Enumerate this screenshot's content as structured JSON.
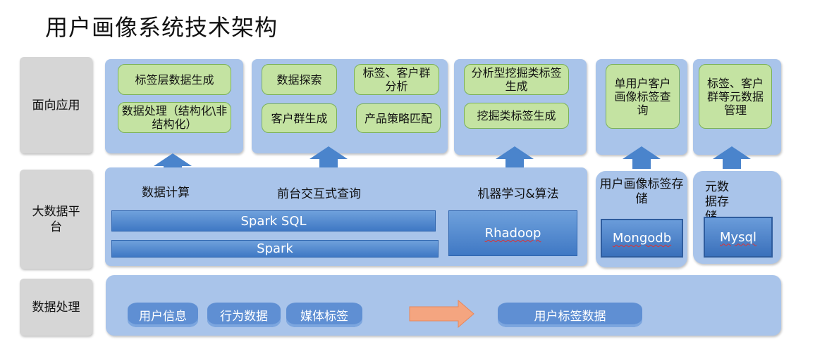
{
  "title": "用户画像系统技术架构",
  "colors": {
    "panel": "#a9c4ea",
    "green_box": "#c4e3a2",
    "blue_bar": "#3f78c4",
    "row_label": "#d6d6d6",
    "flow_arrow": "#f4a580"
  },
  "rows": {
    "application": "面向应用",
    "platform_line1": "大数据平",
    "platform_line2": "台",
    "data_processing": "数据处理"
  },
  "application": {
    "group1": [
      "标签层数据生成",
      "数据处理（结构化\\非结构化）"
    ],
    "group2": [
      "数据探索",
      "标签、客户群分析",
      "客户群生成",
      "产品策略匹配"
    ],
    "group3": [
      "分析型挖掘类标签生成",
      "挖掘类标签生成"
    ],
    "group4": [
      "单用户客户画像标签查询"
    ],
    "group5": [
      "标签、客户群等元数据管理"
    ]
  },
  "platform": {
    "compute_label": "数据计算",
    "query_label": "前台交互式查询",
    "ml_label": "机器学习&算法",
    "spark_sql": "Spark SQL",
    "spark": "Spark",
    "rhadoop": "Rhadoop",
    "portrait_storage_label": "用户画像标签存储",
    "mongodb": "Mongodb",
    "meta_storage_label": "元数据存储",
    "mysql": "Mysql"
  },
  "data_processing": {
    "sources": [
      "用户信息",
      "行为数据",
      "媒体标签"
    ],
    "target": "用户标签数据"
  },
  "icons": [
    "up-arrow-icon",
    "right-arrow-icon"
  ]
}
